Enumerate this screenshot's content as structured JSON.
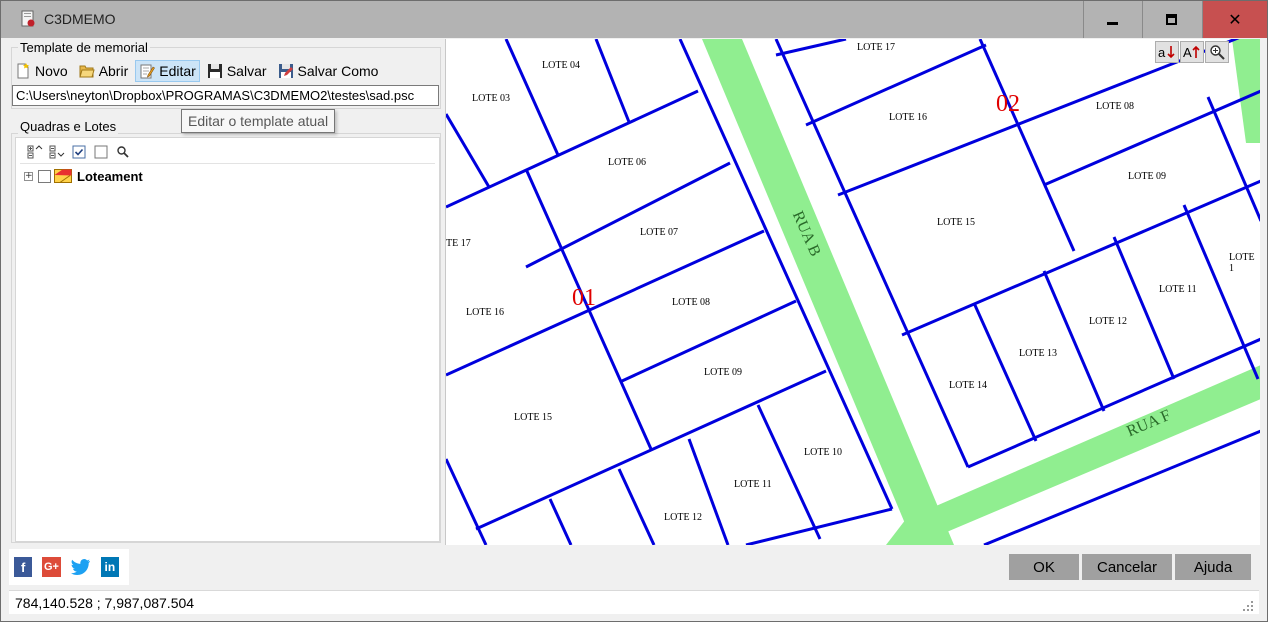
{
  "window": {
    "title": "C3DMEMO",
    "close_glyph": "✕"
  },
  "template_group": {
    "label": "Template de memorial",
    "buttons": {
      "novo": "Novo",
      "abrir": "Abrir",
      "editar": "Editar",
      "salvar": "Salvar",
      "salvar_como": "Salvar Como"
    },
    "path_value": "C:\\Users\\neyton\\Dropbox\\PROGRAMAS\\C3DMEMO2\\testes\\sad.psc",
    "tooltip": "Editar o template atual"
  },
  "tree_group": {
    "label": "Quadras e Lotes",
    "toolbar_icons": [
      "expand-all-icon",
      "collapse-all-icon",
      "check-all-icon",
      "uncheck-all-icon",
      "search-icon"
    ],
    "root_node": {
      "label": "Loteament",
      "expanded": false,
      "checked": false
    }
  },
  "map": {
    "tools": [
      "sort-desc-icon",
      "sort-asc-icon",
      "zoom-extent-icon"
    ],
    "streets": [
      "RUA B",
      "RUA F"
    ],
    "blocks": [
      "01",
      "02"
    ],
    "lots_block_01": [
      "LOTE 03",
      "LOTE 04",
      "LOTE 06",
      "LOTE 07",
      "LOTE 08",
      "LOTE 09",
      "LOTE 10",
      "LOTE 11",
      "LOTE 12",
      "LOTE 15",
      "LOTE 16",
      "TE 17"
    ],
    "lots_block_02": [
      "LOTE 17",
      "LOTE 16",
      "LOTE 08",
      "LOTE 09",
      "LOTE 15",
      "LOTE 1",
      "LOTE 11",
      "LOTE 12",
      "LOTE 13",
      "LOTE 14"
    ],
    "colors": {
      "lot_lines": "#0000dd",
      "street": "#90ee90",
      "block_label": "#e00000"
    }
  },
  "dialog_buttons": {
    "ok": "OK",
    "cancel": "Cancelar",
    "help": "Ajuda"
  },
  "social": [
    "facebook-icon",
    "google-plus-icon",
    "twitter-icon",
    "linkedin-icon"
  ],
  "status": {
    "coords": "784,140.528 ; 7,987,087.504"
  }
}
